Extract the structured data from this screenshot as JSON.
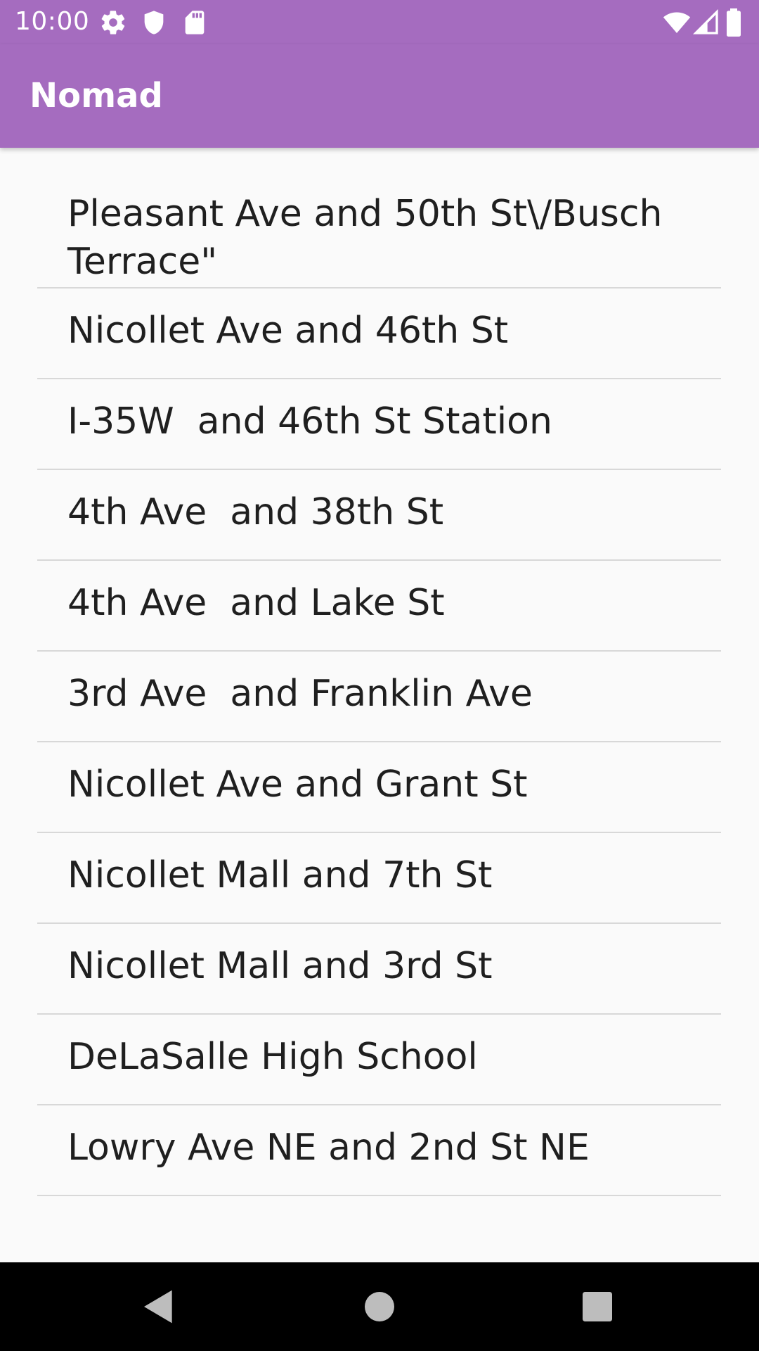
{
  "status_bar": {
    "time": "10:00",
    "icons": [
      "gear-icon",
      "shield-icon",
      "sd-card-icon",
      "wifi-icon",
      "cell-signal-icon",
      "battery-icon"
    ]
  },
  "app_bar": {
    "title": "Nomad",
    "color": "#a56cbf"
  },
  "stops": [
    {
      "label": "Pleasant Ave and 50th St\\/Busch Terrace\""
    },
    {
      "label": "Nicollet Ave and 46th St"
    },
    {
      "label": "I-35W  and 46th St Station"
    },
    {
      "label": "4th Ave  and 38th St"
    },
    {
      "label": "4th Ave  and Lake St"
    },
    {
      "label": "3rd Ave  and Franklin Ave"
    },
    {
      "label": "Nicollet Ave and Grant St"
    },
    {
      "label": "Nicollet Mall and 7th St"
    },
    {
      "label": "Nicollet Mall and 3rd St"
    },
    {
      "label": "DeLaSalle High School"
    },
    {
      "label": "Lowry Ave NE and 2nd St NE"
    }
  ],
  "nav_bar": {
    "icons": [
      "back-icon",
      "home-icon",
      "recents-icon"
    ]
  }
}
